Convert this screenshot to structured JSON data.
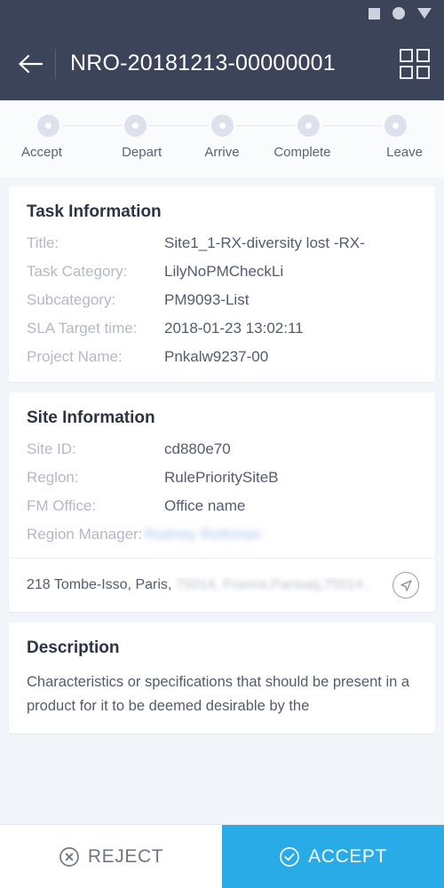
{
  "statusbar": {
    "icons": [
      "square-icon",
      "circle-icon",
      "triangle-down-icon"
    ]
  },
  "appbar": {
    "back_icon": "back-arrow-icon",
    "title": "NRO-20181213-00000001",
    "grid_icon": "grid-menu-icon"
  },
  "stepper": {
    "steps": [
      {
        "label": "Accept",
        "state": "inactive"
      },
      {
        "label": "Depart",
        "state": "inactive"
      },
      {
        "label": "Arrive",
        "state": "inactive"
      },
      {
        "label": "Complete",
        "state": "inactive"
      },
      {
        "label": "Leave",
        "state": "inactive"
      }
    ]
  },
  "task_information": {
    "title": "Task Information",
    "rows": [
      {
        "label": "Title:",
        "value": "Site1_1-RX-diversity lost -RX-"
      },
      {
        "label": "Task Category:",
        "value": "LilyNoPMCheckLi"
      },
      {
        "label": "Subcategory:",
        "value": "PM9093-List"
      },
      {
        "label": "SLA Target time:",
        "value": "2018-01-23 13:02:11"
      },
      {
        "label": "Project Name:",
        "value": "Pnkalw9237-00"
      }
    ]
  },
  "site_information": {
    "title": "Site Information",
    "rows": [
      {
        "label": "Site ID:",
        "value": "cd880e70"
      },
      {
        "label": "Reglon:",
        "value": "RulePrioritySiteB"
      },
      {
        "label": "FM Office:",
        "value": "Office name"
      }
    ],
    "manager_label": "Region Manager:",
    "manager_value": "Rodney Rothman",
    "address_visible": "218 Tombe-Isso, Paris,",
    "address_redacted": "75014, France,Parisaq,75014..",
    "nav_icon": "navigate-arrow-icon"
  },
  "description": {
    "title": "Description",
    "body": "Characteristics or specifications that should be present in a product for it to be deemed desirable by the"
  },
  "bottombar": {
    "reject_label": "REJECT",
    "reject_icon": "circle-x-icon",
    "accept_label": "ACCEPT",
    "accept_icon": "circle-check-icon"
  },
  "colors": {
    "appbar": "#3c4459",
    "accent": "#29abe8",
    "background": "#f2f5fa",
    "card": "#ffffff",
    "label": "#b3b9c5",
    "value": "#535c6c"
  }
}
